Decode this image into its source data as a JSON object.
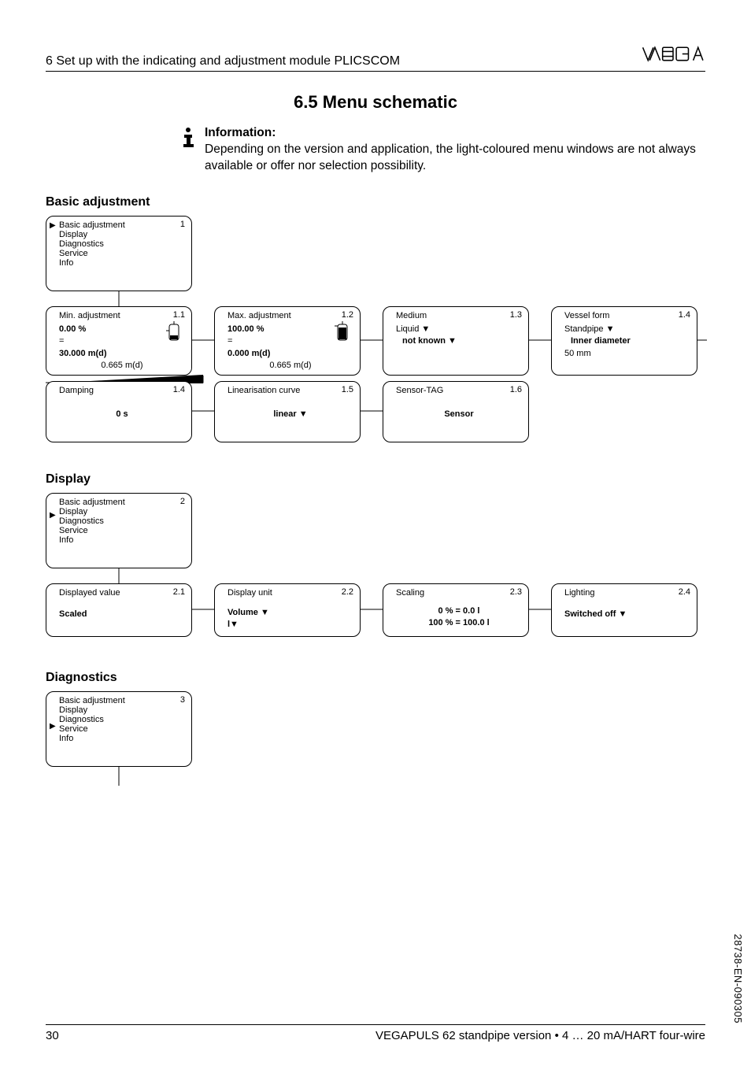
{
  "header": {
    "chapter": "6   Set up with the indicating and adjustment module PLICSCOM"
  },
  "section_title": "6.5   Menu schematic",
  "info": {
    "heading": "Information:",
    "body": "Depending on the version and application, the light-coloured menu windows are not always available or offer nor selection possibility."
  },
  "subsections": {
    "basic": "Basic adjustment",
    "display": "Display",
    "diag": "Diagnostics"
  },
  "menu_labels": [
    "Basic adjustment",
    "Display",
    "Diagnostics",
    "Service",
    "Info"
  ],
  "boxes": {
    "basic_menu": {
      "num": "1",
      "selected": 0
    },
    "display_menu": {
      "num": "2",
      "selected": 1
    },
    "diag_menu": {
      "num": "3",
      "selected": 2
    },
    "min_adj": {
      "num": "1.1",
      "title": "Min. adjustment",
      "l1": "0.00 %",
      "l2": "=",
      "l3": "30.000 m(d)",
      "l4": "0.665 m(d)"
    },
    "max_adj": {
      "num": "1.2",
      "title": "Max. adjustment",
      "l1": "100.00 %",
      "l2": "=",
      "l3": "0.000 m(d)",
      "l4": "0.665 m(d)"
    },
    "medium": {
      "num": "1.3",
      "title": "Medium",
      "l1": "Liquid ▼",
      "l2": "not known ▼"
    },
    "vessel": {
      "num": "1.4",
      "title": "Vessel form",
      "l1": "Standpipe ▼",
      "l2": "Inner diameter",
      "l3": "50 mm"
    },
    "damping": {
      "num": "1.4",
      "title": "Damping",
      "center": "0 s"
    },
    "lincurve": {
      "num": "1.5",
      "title": "Linearisation curve",
      "center": "linear ▼"
    },
    "sensortag": {
      "num": "1.6",
      "title": "Sensor-TAG",
      "center": "Sensor"
    },
    "dispval": {
      "num": "2.1",
      "title": "Displayed value",
      "l1": "Scaled"
    },
    "dispunit": {
      "num": "2.2",
      "title": "Display unit",
      "l1": "Volume ▼",
      "l2": "l▼"
    },
    "scaling": {
      "num": "2.3",
      "title": "Scaling",
      "l1": "0 % = 0.0 l",
      "l2": "100 % = 100.0 l"
    },
    "lighting": {
      "num": "2.4",
      "title": "Lighting",
      "l1": "Switched off ▼"
    }
  },
  "footer": {
    "page": "30",
    "product": "VEGAPULS 62 standpipe version • 4 … 20 mA/HART four-wire"
  },
  "side_code": "28738-EN-090305"
}
